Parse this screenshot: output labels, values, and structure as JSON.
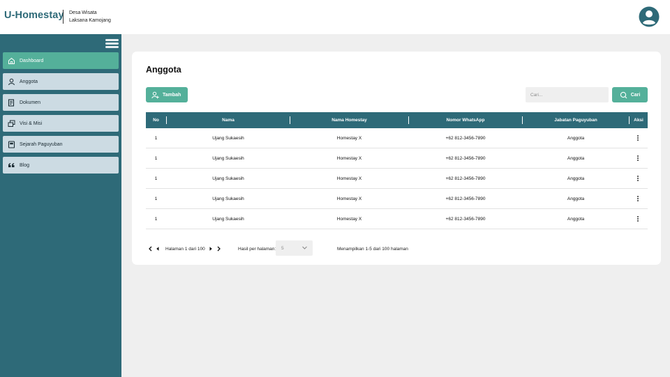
{
  "header": {
    "brand": "U-Homestay",
    "subtitle_line1": "Desa Wisata",
    "subtitle_line2": "Laksana Kamojang",
    "avatar_icon": "user-circle-icon"
  },
  "sidebar": {
    "items": [
      {
        "label": "Dashboard",
        "icon": "home-icon",
        "active": true
      },
      {
        "label": "Anggota",
        "icon": "user-icon",
        "active": false
      },
      {
        "label": "Dokumen",
        "icon": "document-icon",
        "active": false
      },
      {
        "label": "Visi & Misi",
        "icon": "layers-icon",
        "active": false
      },
      {
        "label": "Sejarah Paguyuban",
        "icon": "book-icon",
        "active": false
      },
      {
        "label": "Blog",
        "icon": "quote-icon",
        "active": false
      }
    ]
  },
  "main": {
    "title": "Anggota",
    "add_button": "Tambah",
    "search_placeholder": "Cari...",
    "search_button": "Cari",
    "table": {
      "headers": [
        "No",
        "Nama",
        "Nama Homestay",
        "Nomor WhatsApp",
        "Jabatan Paguyuban",
        "Aksi"
      ],
      "rows": [
        [
          "1",
          "Ujang Sukaesih",
          "Homestay X",
          "+62 812-3456-7890",
          "Anggota"
        ],
        [
          "1",
          "Ujang Sukaesih",
          "Homestay X",
          "+62 812-3456-7890",
          "Anggota"
        ],
        [
          "1",
          "Ujang Sukaesih",
          "Homestay X",
          "+62 812-3456-7890",
          "Anggota"
        ],
        [
          "1",
          "Ujang Sukaesih",
          "Homestay X",
          "+62 812-3456-7890",
          "Anggota"
        ],
        [
          "1",
          "Ujang Sukaesih",
          "Homestay X",
          "+62 812-3456-7890",
          "Anggota"
        ]
      ]
    },
    "pagination": {
      "page_text": "Halaman 1 dari 100",
      "per_page_label": "Hasil per halaman:",
      "per_page_value": "5",
      "summary": "Menampilkan 1-5 dari 100 halaman"
    }
  },
  "colors": {
    "primary": "#2e6a78",
    "accent": "#54b09a",
    "nav_inactive": "#ccdbe3",
    "background": "#efefef"
  }
}
